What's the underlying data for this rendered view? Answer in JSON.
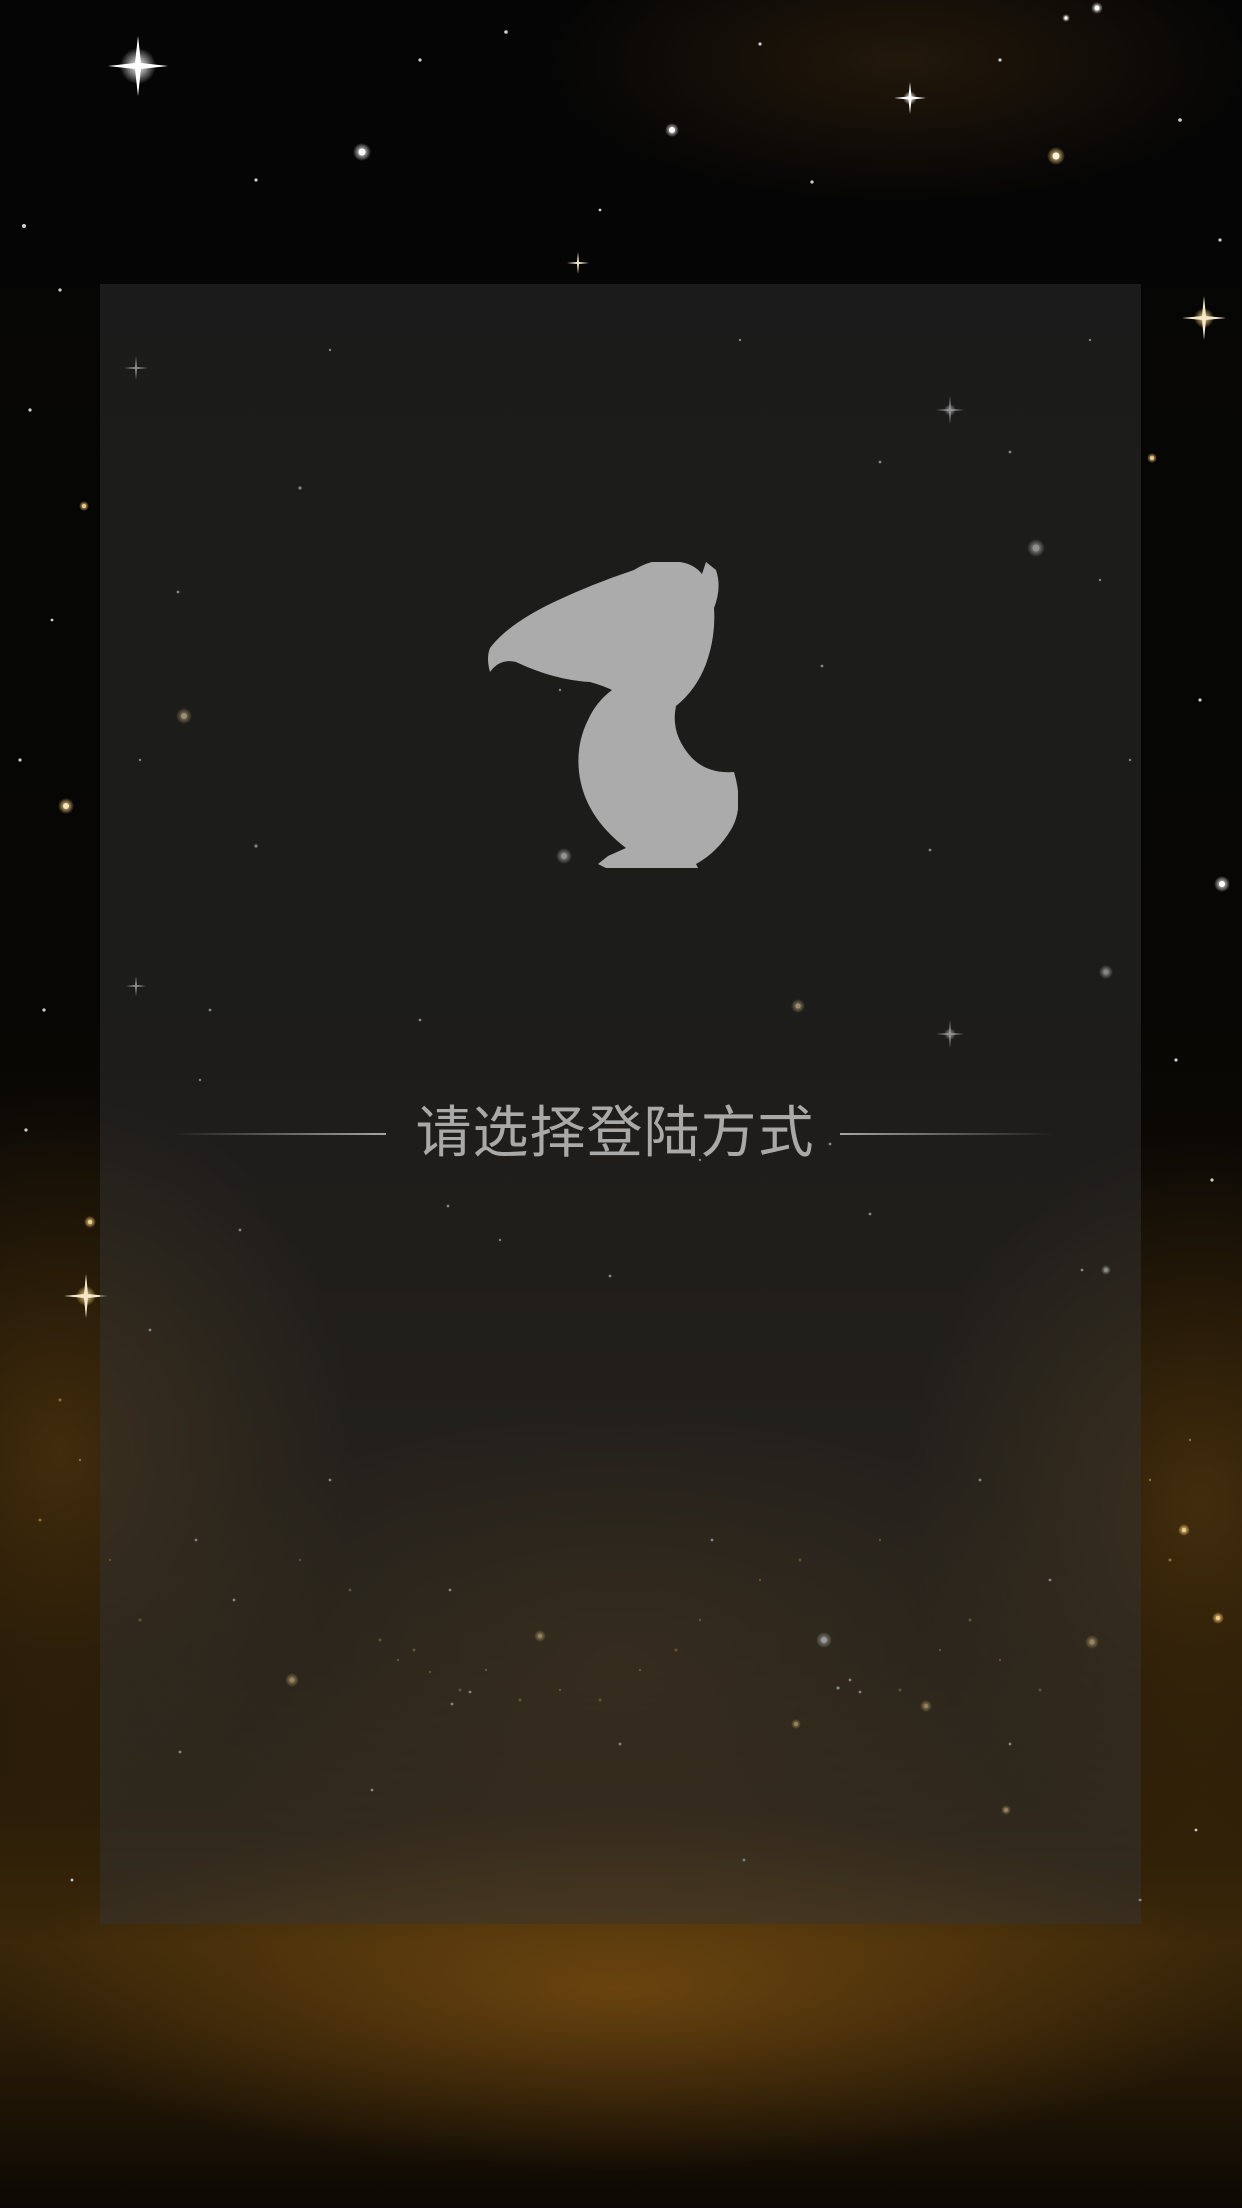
{
  "screen": {
    "name": "login-method-screen",
    "background": "starry-night-gold-nebula"
  },
  "panel": {
    "color": "#343434"
  },
  "logo": {
    "icon": "pelican-logo-icon",
    "color": "#ababab"
  },
  "login": {
    "prompt": "请选择登陆方式"
  },
  "colors": {
    "prompt_text": "#a9a9a9",
    "accent_gold": "#c8963c"
  }
}
